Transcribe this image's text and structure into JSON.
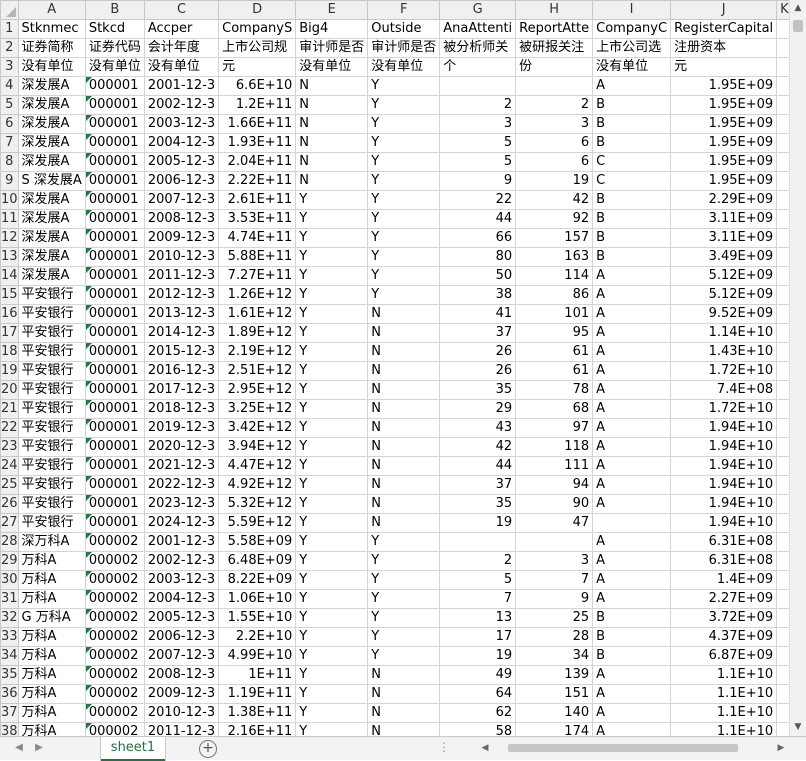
{
  "columns": [
    "A",
    "B",
    "C",
    "D",
    "E",
    "F",
    "G",
    "H",
    "I",
    "J",
    "K"
  ],
  "rows": [
    [
      "1",
      "Stknmec",
      "Stkcd",
      "Accper",
      "CompanyS",
      "Big4",
      "Outside",
      "AnaAttenti",
      "ReportAtte",
      "CompanyC",
      "RegisterCapital",
      ""
    ],
    [
      "2",
      "证券简称",
      "证券代码",
      "会计年度",
      "上市公司规",
      "审计师是否",
      "审计师是否",
      "被分析师关",
      "被研报关注",
      "上市公司选",
      "注册资本",
      ""
    ],
    [
      "3",
      "没有单位",
      "没有单位",
      "没有单位",
      "元",
      "没有单位",
      "没有单位",
      "个",
      "份",
      "没有单位",
      "元",
      ""
    ],
    [
      "4",
      "深发展A",
      "000001",
      "2001-12-3",
      "6.6E+10",
      "N",
      "Y",
      "",
      "",
      "A",
      "1.95E+09",
      ""
    ],
    [
      "5",
      "深发展A",
      "000001",
      "2002-12-3",
      "1.2E+11",
      "N",
      "Y",
      "2",
      "2",
      "B",
      "1.95E+09",
      ""
    ],
    [
      "6",
      "深发展A",
      "000001",
      "2003-12-3",
      "1.66E+11",
      "N",
      "Y",
      "3",
      "3",
      "B",
      "1.95E+09",
      ""
    ],
    [
      "7",
      "深发展A",
      "000001",
      "2004-12-3",
      "1.93E+11",
      "N",
      "Y",
      "5",
      "6",
      "B",
      "1.95E+09",
      ""
    ],
    [
      "8",
      "深发展A",
      "000001",
      "2005-12-3",
      "2.04E+11",
      "N",
      "Y",
      "5",
      "6",
      "C",
      "1.95E+09",
      ""
    ],
    [
      "9",
      "S 深发展A",
      "000001",
      "2006-12-3",
      "2.22E+11",
      "N",
      "Y",
      "9",
      "19",
      "C",
      "1.95E+09",
      ""
    ],
    [
      "10",
      "深发展A",
      "000001",
      "2007-12-3",
      "2.61E+11",
      "Y",
      "Y",
      "22",
      "42",
      "B",
      "2.29E+09",
      ""
    ],
    [
      "11",
      "深发展A",
      "000001",
      "2008-12-3",
      "3.53E+11",
      "Y",
      "Y",
      "44",
      "92",
      "B",
      "3.11E+09",
      ""
    ],
    [
      "12",
      "深发展A",
      "000001",
      "2009-12-3",
      "4.74E+11",
      "Y",
      "Y",
      "66",
      "157",
      "B",
      "3.11E+09",
      ""
    ],
    [
      "13",
      "深发展A",
      "000001",
      "2010-12-3",
      "5.88E+11",
      "Y",
      "Y",
      "80",
      "163",
      "B",
      "3.49E+09",
      ""
    ],
    [
      "14",
      "深发展A",
      "000001",
      "2011-12-3",
      "7.27E+11",
      "Y",
      "Y",
      "50",
      "114",
      "A",
      "5.12E+09",
      ""
    ],
    [
      "15",
      "平安银行",
      "000001",
      "2012-12-3",
      "1.26E+12",
      "Y",
      "Y",
      "38",
      "86",
      "A",
      "5.12E+09",
      ""
    ],
    [
      "16",
      "平安银行",
      "000001",
      "2013-12-3",
      "1.61E+12",
      "Y",
      "N",
      "41",
      "101",
      "A",
      "9.52E+09",
      ""
    ],
    [
      "17",
      "平安银行",
      "000001",
      "2014-12-3",
      "1.89E+12",
      "Y",
      "N",
      "37",
      "95",
      "A",
      "1.14E+10",
      ""
    ],
    [
      "18",
      "平安银行",
      "000001",
      "2015-12-3",
      "2.19E+12",
      "Y",
      "N",
      "26",
      "61",
      "A",
      "1.43E+10",
      ""
    ],
    [
      "19",
      "平安银行",
      "000001",
      "2016-12-3",
      "2.51E+12",
      "Y",
      "N",
      "26",
      "61",
      "A",
      "1.72E+10",
      ""
    ],
    [
      "20",
      "平安银行",
      "000001",
      "2017-12-3",
      "2.95E+12",
      "Y",
      "N",
      "35",
      "78",
      "A",
      "7.4E+08",
      ""
    ],
    [
      "21",
      "平安银行",
      "000001",
      "2018-12-3",
      "3.25E+12",
      "Y",
      "N",
      "29",
      "68",
      "A",
      "1.72E+10",
      ""
    ],
    [
      "22",
      "平安银行",
      "000001",
      "2019-12-3",
      "3.42E+12",
      "Y",
      "N",
      "43",
      "97",
      "A",
      "1.94E+10",
      ""
    ],
    [
      "23",
      "平安银行",
      "000001",
      "2020-12-3",
      "3.94E+12",
      "Y",
      "N",
      "42",
      "118",
      "A",
      "1.94E+10",
      ""
    ],
    [
      "24",
      "平安银行",
      "000001",
      "2021-12-3",
      "4.47E+12",
      "Y",
      "N",
      "44",
      "111",
      "A",
      "1.94E+10",
      ""
    ],
    [
      "25",
      "平安银行",
      "000001",
      "2022-12-3",
      "4.92E+12",
      "Y",
      "N",
      "37",
      "94",
      "A",
      "1.94E+10",
      ""
    ],
    [
      "26",
      "平安银行",
      "000001",
      "2023-12-3",
      "5.32E+12",
      "Y",
      "N",
      "35",
      "90",
      "A",
      "1.94E+10",
      ""
    ],
    [
      "27",
      "平安银行",
      "000001",
      "2024-12-3",
      "5.59E+12",
      "Y",
      "N",
      "19",
      "47",
      "",
      "1.94E+10",
      ""
    ],
    [
      "28",
      "深万科A",
      "000002",
      "2001-12-3",
      "5.58E+09",
      "Y",
      "Y",
      "",
      "",
      "A",
      "6.31E+08",
      ""
    ],
    [
      "29",
      "万科A",
      "000002",
      "2002-12-3",
      "6.48E+09",
      "Y",
      "Y",
      "2",
      "3",
      "A",
      "6.31E+08",
      ""
    ],
    [
      "30",
      "万科A",
      "000002",
      "2003-12-3",
      "8.22E+09",
      "Y",
      "Y",
      "5",
      "7",
      "A",
      "1.4E+09",
      ""
    ],
    [
      "31",
      "万科A",
      "000002",
      "2004-12-3",
      "1.06E+10",
      "Y",
      "Y",
      "7",
      "9",
      "A",
      "2.27E+09",
      ""
    ],
    [
      "32",
      "G 万科A",
      "000002",
      "2005-12-3",
      "1.55E+10",
      "Y",
      "Y",
      "13",
      "25",
      "B",
      "3.72E+09",
      ""
    ],
    [
      "33",
      "万科A",
      "000002",
      "2006-12-3",
      "2.2E+10",
      "Y",
      "Y",
      "17",
      "28",
      "B",
      "4.37E+09",
      ""
    ],
    [
      "34",
      "万科A",
      "000002",
      "2007-12-3",
      "4.99E+10",
      "Y",
      "Y",
      "19",
      "34",
      "B",
      "6.87E+09",
      ""
    ],
    [
      "35",
      "万科A",
      "000002",
      "2008-12-3",
      "1E+11",
      "Y",
      "N",
      "49",
      "139",
      "A",
      "1.1E+10",
      ""
    ],
    [
      "36",
      "万科A",
      "000002",
      "2009-12-3",
      "1.19E+11",
      "Y",
      "N",
      "64",
      "151",
      "A",
      "1.1E+10",
      ""
    ],
    [
      "37",
      "万科A",
      "000002",
      "2010-12-3",
      "1.38E+11",
      "Y",
      "N",
      "62",
      "140",
      "A",
      "1.1E+10",
      ""
    ],
    [
      "38",
      "万科A",
      "000002",
      "2011-12-3",
      "2.16E+11",
      "Y",
      "N",
      "58",
      "174",
      "A",
      "1.1E+10",
      ""
    ]
  ],
  "tabs": {
    "sheet_name": "sheet1",
    "add_sheet": "⊕"
  },
  "colors": {
    "accent": "#217346",
    "header_bg": "#f0f0f0",
    "grid": "#d4d4d4"
  }
}
